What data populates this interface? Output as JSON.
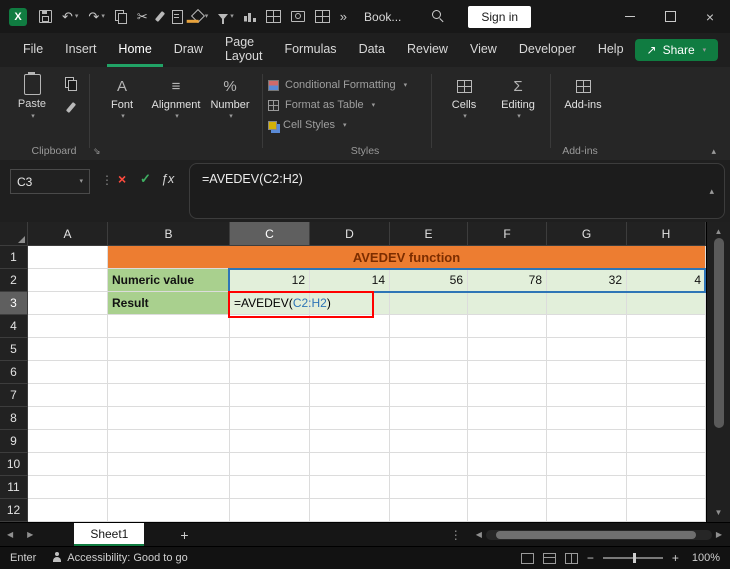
{
  "colors": {
    "green": "#21A366",
    "green_dark": "#107C41",
    "orange": "#ED7D31",
    "orange_text": "#7C2D00",
    "label_green": "#A9D08E",
    "value_green": "#E2EFDA",
    "blue": "#2E75B6",
    "red": "#FF0000"
  },
  "icons": {
    "excel_logo": "X",
    "undo": "↶",
    "redo": "↷",
    "cut": "✂",
    "more_commands": "»",
    "chevron_down": "▾",
    "chevron_up": "▴",
    "close": "×",
    "dots_vertical": "⋮",
    "cancel": "×",
    "check": "✓",
    "fx": "ƒx",
    "font_letter": "A",
    "align_lines": "≡",
    "percent": "%",
    "sigma": "Σ",
    "share": "↗",
    "arrow_left": "◀",
    "arrow_right": "▶",
    "arrow_up": "▲",
    "arrow_down": "▼",
    "plus": "+",
    "minus": "−"
  },
  "titlebar": {
    "workbook_name": "Book...",
    "sign_in": "Sign in"
  },
  "menubar": {
    "items": [
      "File",
      "Insert",
      "Home",
      "Draw",
      "Page Layout",
      "Formulas",
      "Data",
      "Review",
      "View",
      "Developer",
      "Help"
    ],
    "active_item": "Home",
    "share_label": "Share"
  },
  "ribbon": {
    "paste_label": "Paste",
    "font_label": "Font",
    "alignment_label": "Alignment",
    "number_label": "Number",
    "styles_items": [
      "Conditional Formatting",
      "Format as Table",
      "Cell Styles"
    ],
    "cells_label": "Cells",
    "editing_label": "Editing",
    "addins_label": "Add-ins",
    "group_clipboard": "Clipboard",
    "group_styles": "Styles",
    "group_addins": "Add-ins"
  },
  "formula_bar": {
    "name_box": "C3",
    "formula": "=AVEDEV(C2:H2)"
  },
  "grid": {
    "columns": [
      "A",
      "B",
      "C",
      "D",
      "E",
      "F",
      "G",
      "H"
    ],
    "selected_column": "C",
    "row_numbers": [
      "1",
      "2",
      "3",
      "4",
      "5",
      "6",
      "7",
      "8",
      "9",
      "10",
      "11",
      "12"
    ],
    "selected_row": "3",
    "cells": {
      "title": "AVEDEV function",
      "numeric_label": "Numeric value",
      "values": [
        "12",
        "14",
        "56",
        "78",
        "32",
        "4"
      ],
      "result_label": "Result",
      "formula_prefix": "=AVEDEV(",
      "formula_range": "C2:H2",
      "formula_suffix": ")"
    }
  },
  "sheetbar": {
    "tab": "Sheet1"
  },
  "statusbar": {
    "mode": "Enter",
    "accessibility": "Accessibility: Good to go",
    "zoom_level": "100%"
  }
}
